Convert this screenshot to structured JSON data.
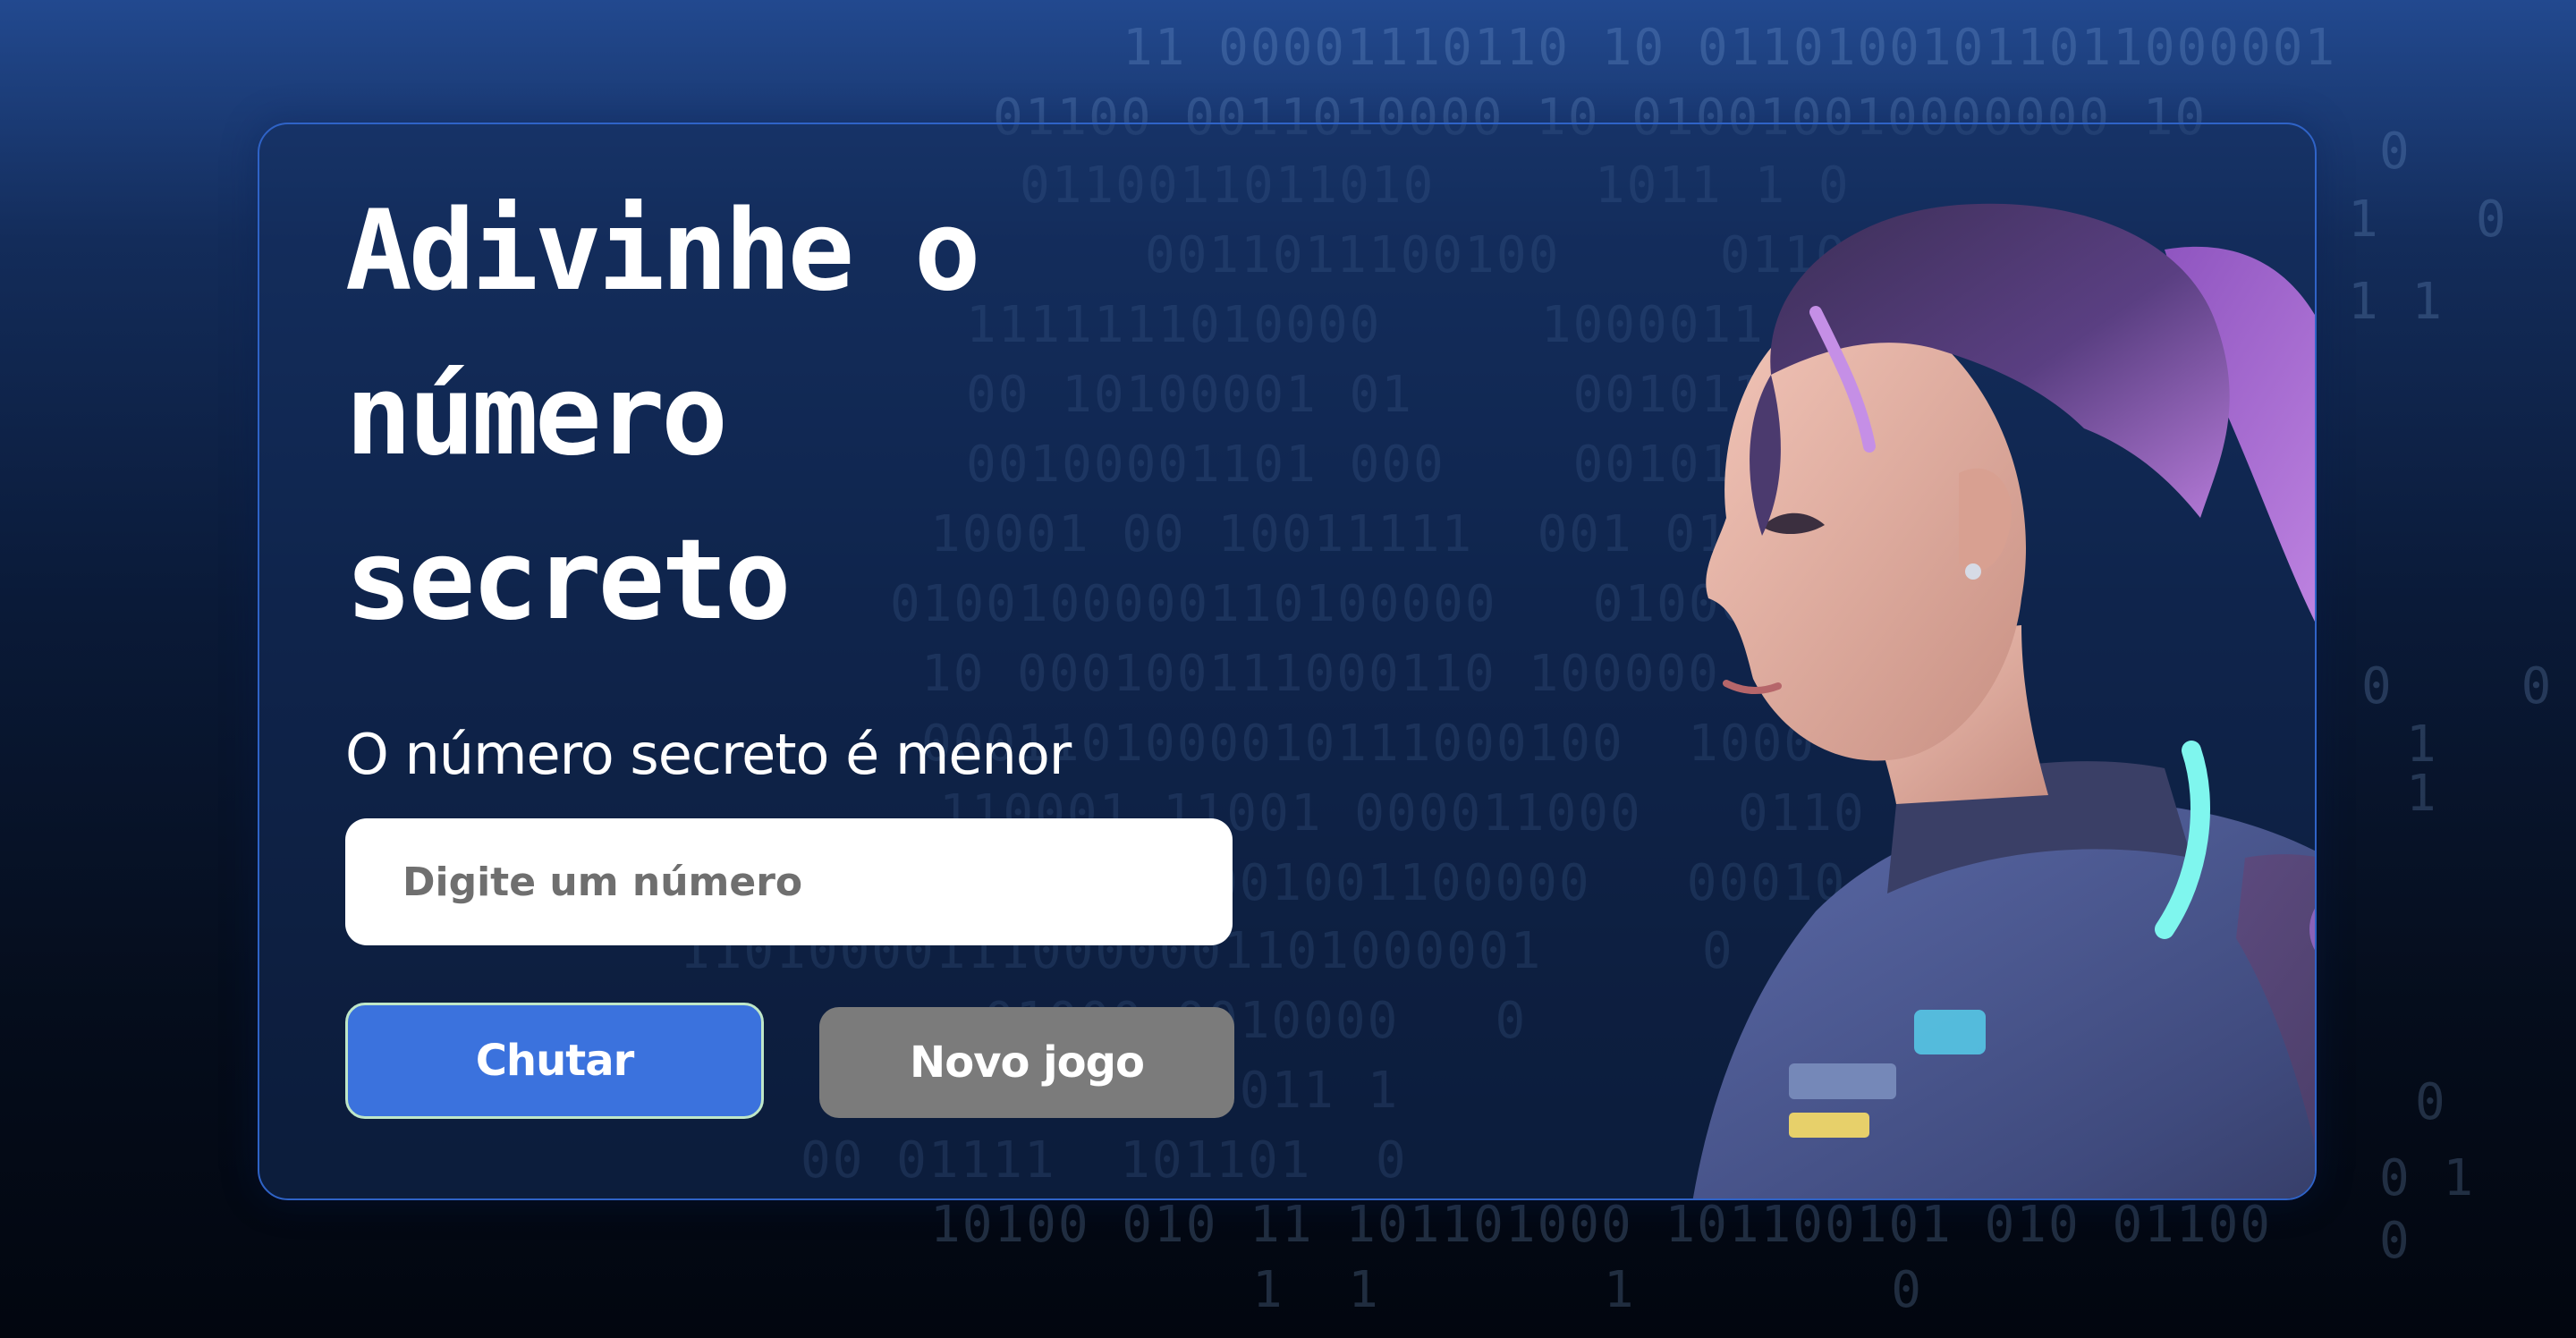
{
  "title": "Adivinhe o número secreto",
  "hint_text": "O número secreto é menor",
  "input": {
    "placeholder": "Digite um número",
    "value": ""
  },
  "buttons": {
    "guess_label": "Chutar",
    "new_game_label": "Novo jogo"
  },
  "colors": {
    "background_top": "#22498f",
    "background_bottom": "#02060f",
    "card_border": "#2f63c7",
    "guess_button": "#3b72dd",
    "new_game_button": "#7b7b7b",
    "input_background": "#ffffff"
  },
  "illustration": "cyber-girl-purple-hair-space-suit"
}
